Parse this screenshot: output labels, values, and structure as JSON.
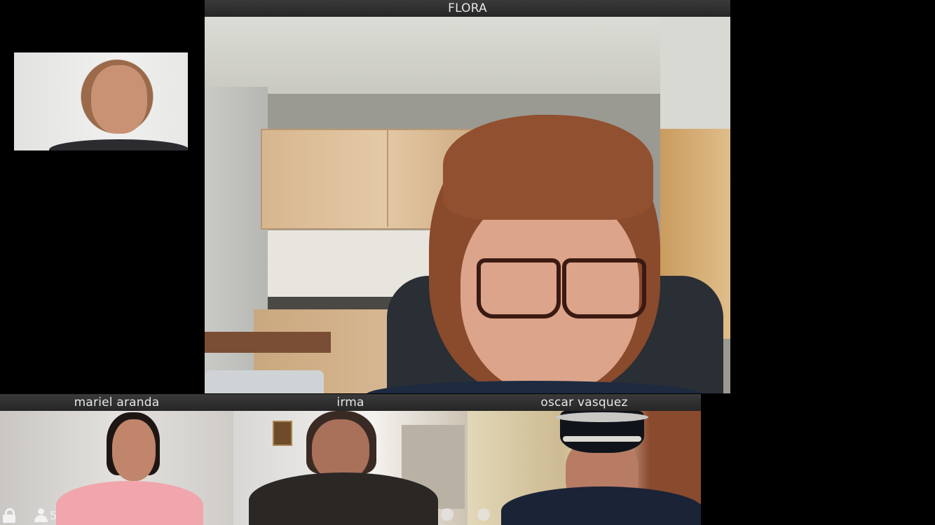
{
  "main_speaker": {
    "name": "FLORA"
  },
  "participants": [
    {
      "name": "mariel aranda"
    },
    {
      "name": "irma"
    },
    {
      "name": "oscar vasquez"
    }
  ],
  "controls": {
    "lock_icon": "lock-icon",
    "participants_icon": "participants-icon",
    "participant_count": "5"
  },
  "colors": {
    "background": "#000000",
    "name_bar": "#2e2e2e",
    "name_text": "#e6e6e6"
  }
}
